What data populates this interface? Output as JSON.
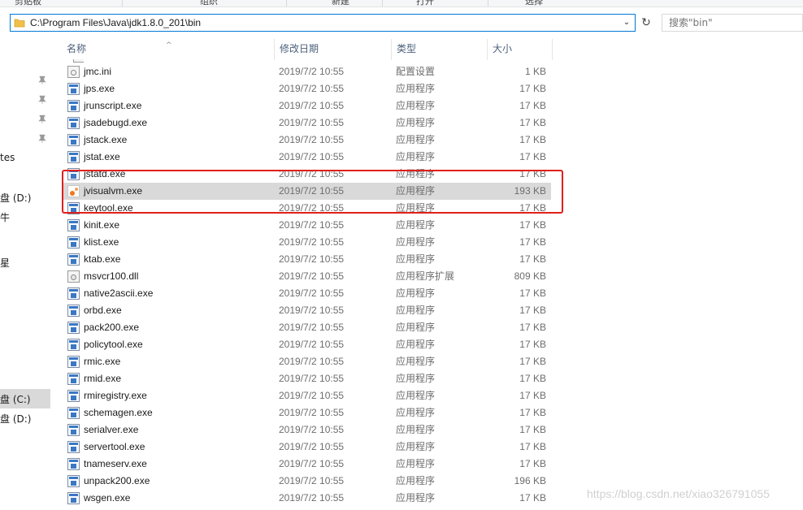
{
  "ribbon": {
    "labels": [
      "剪贴板",
      "组织",
      "新建",
      "打开",
      "选择"
    ]
  },
  "address": {
    "path": "C:\\Program Files\\Java\\jdk1.8.0_201\\bin"
  },
  "search": {
    "placeholder": "搜索\"bin\""
  },
  "nav": {
    "items": [
      "tes",
      "盘 (D:)",
      "牛",
      "星",
      "盘 (C:)",
      "盘 (D:)"
    ],
    "selected_index": 4
  },
  "columns": {
    "name": "名称",
    "date": "修改日期",
    "type": "类型",
    "size": "大小"
  },
  "files": [
    {
      "name": "jmc.ini",
      "date": "2019/7/2 10:55",
      "type": "配置设置",
      "size": "1 KB",
      "icon": "ini-file-icon"
    },
    {
      "name": "jps.exe",
      "date": "2019/7/2 10:55",
      "type": "应用程序",
      "size": "17 KB",
      "icon": "exe-file-icon"
    },
    {
      "name": "jrunscript.exe",
      "date": "2019/7/2 10:55",
      "type": "应用程序",
      "size": "17 KB",
      "icon": "exe-file-icon"
    },
    {
      "name": "jsadebugd.exe",
      "date": "2019/7/2 10:55",
      "type": "应用程序",
      "size": "17 KB",
      "icon": "exe-file-icon"
    },
    {
      "name": "jstack.exe",
      "date": "2019/7/2 10:55",
      "type": "应用程序",
      "size": "17 KB",
      "icon": "exe-file-icon"
    },
    {
      "name": "jstat.exe",
      "date": "2019/7/2 10:55",
      "type": "应用程序",
      "size": "17 KB",
      "icon": "exe-file-icon"
    },
    {
      "name": "jstatd.exe",
      "date": "2019/7/2 10:55",
      "type": "应用程序",
      "size": "17 KB",
      "icon": "exe-file-icon"
    },
    {
      "name": "jvisualvm.exe",
      "date": "2019/7/2 10:55",
      "type": "应用程序",
      "size": "193 KB",
      "icon": "jvisualvm-icon",
      "selected": true
    },
    {
      "name": "keytool.exe",
      "date": "2019/7/2 10:55",
      "type": "应用程序",
      "size": "17 KB",
      "icon": "exe-file-icon"
    },
    {
      "name": "kinit.exe",
      "date": "2019/7/2 10:55",
      "type": "应用程序",
      "size": "17 KB",
      "icon": "exe-file-icon"
    },
    {
      "name": "klist.exe",
      "date": "2019/7/2 10:55",
      "type": "应用程序",
      "size": "17 KB",
      "icon": "exe-file-icon"
    },
    {
      "name": "ktab.exe",
      "date": "2019/7/2 10:55",
      "type": "应用程序",
      "size": "17 KB",
      "icon": "exe-file-icon"
    },
    {
      "name": "msvcr100.dll",
      "date": "2019/7/2 10:55",
      "type": "应用程序扩展",
      "size": "809 KB",
      "icon": "dll-file-icon"
    },
    {
      "name": "native2ascii.exe",
      "date": "2019/7/2 10:55",
      "type": "应用程序",
      "size": "17 KB",
      "icon": "exe-file-icon"
    },
    {
      "name": "orbd.exe",
      "date": "2019/7/2 10:55",
      "type": "应用程序",
      "size": "17 KB",
      "icon": "exe-file-icon"
    },
    {
      "name": "pack200.exe",
      "date": "2019/7/2 10:55",
      "type": "应用程序",
      "size": "17 KB",
      "icon": "exe-file-icon"
    },
    {
      "name": "policytool.exe",
      "date": "2019/7/2 10:55",
      "type": "应用程序",
      "size": "17 KB",
      "icon": "exe-file-icon"
    },
    {
      "name": "rmic.exe",
      "date": "2019/7/2 10:55",
      "type": "应用程序",
      "size": "17 KB",
      "icon": "exe-file-icon"
    },
    {
      "name": "rmid.exe",
      "date": "2019/7/2 10:55",
      "type": "应用程序",
      "size": "17 KB",
      "icon": "exe-file-icon"
    },
    {
      "name": "rmiregistry.exe",
      "date": "2019/7/2 10:55",
      "type": "应用程序",
      "size": "17 KB",
      "icon": "exe-file-icon"
    },
    {
      "name": "schemagen.exe",
      "date": "2019/7/2 10:55",
      "type": "应用程序",
      "size": "17 KB",
      "icon": "exe-file-icon"
    },
    {
      "name": "serialver.exe",
      "date": "2019/7/2 10:55",
      "type": "应用程序",
      "size": "17 KB",
      "icon": "exe-file-icon"
    },
    {
      "name": "servertool.exe",
      "date": "2019/7/2 10:55",
      "type": "应用程序",
      "size": "17 KB",
      "icon": "exe-file-icon"
    },
    {
      "name": "tnameserv.exe",
      "date": "2019/7/2 10:55",
      "type": "应用程序",
      "size": "17 KB",
      "icon": "exe-file-icon"
    },
    {
      "name": "unpack200.exe",
      "date": "2019/7/2 10:55",
      "type": "应用程序",
      "size": "196 KB",
      "icon": "exe-file-icon"
    },
    {
      "name": "wsgen.exe",
      "date": "2019/7/2 10:55",
      "type": "应用程序",
      "size": "17 KB",
      "icon": "exe-file-icon"
    }
  ],
  "watermark": "https://blog.csdn.net/xiao326791055",
  "colors": {
    "selected_row": "#d9d9d9",
    "annotation_box": "#e0201b",
    "address_border": "#0078d7"
  }
}
